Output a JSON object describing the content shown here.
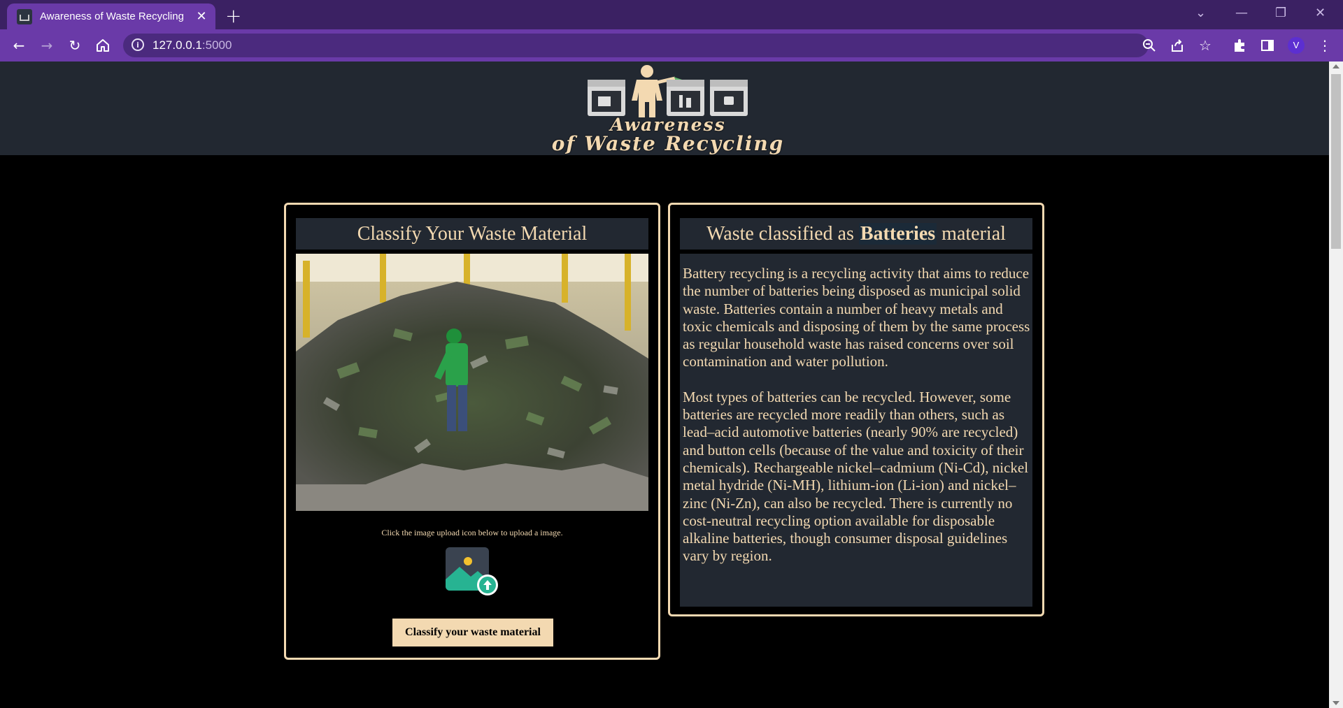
{
  "browser": {
    "tab_title": "Awareness of Waste Recycling",
    "tab_close": "✕",
    "new_tab": "+",
    "url_host": "127.0.0.1",
    "url_port": ":5000",
    "avatar_initial": "V"
  },
  "header": {
    "logo_line1": "Awareness",
    "logo_line2": "of Waste Recycling"
  },
  "classify_panel": {
    "title": "Classify Your Waste Material",
    "hint": "Click the image upload icon below to upload a image.",
    "button_label": "Classify your waste material"
  },
  "result_panel": {
    "title_prefix": "Waste classified as ",
    "class_name": "Batteries",
    "title_suffix": " material",
    "paragraph1": "Battery recycling is a recycling activity that aims to reduce the number of batteries being disposed as municipal solid waste. Batteries contain a number of heavy metals and toxic chemicals and disposing of them by the same process as regular household waste has raised concerns over soil contamination and water pollution.",
    "paragraph2": "Most types of batteries can be recycled. However, some batteries are recycled more readily than others, such as lead–acid automotive batteries (nearly 90% are recycled) and button cells (because of the value and toxicity of their chemicals). Rechargeable nickel–cadmium (Ni-Cd), nickel metal hydride (Ni-MH), lithium-ion (Li-ion) and nickel–zinc (Ni-Zn), can also be recycled. There is currently no cost-neutral recycling option available for disposable alkaline batteries, though consumer disposal guidelines vary by region."
  },
  "colors": {
    "accent": "#f3d9b1",
    "panel_bg": "#222831",
    "browser_frame": "#6a3aa8"
  }
}
